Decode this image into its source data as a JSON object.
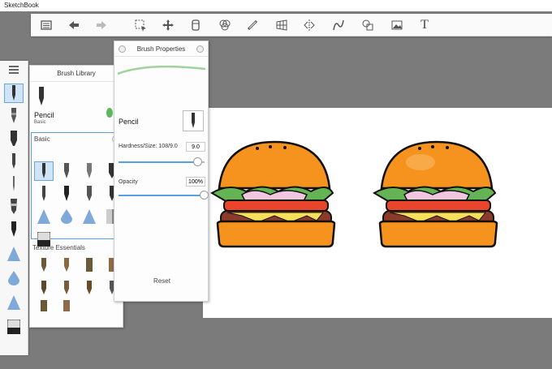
{
  "app": {
    "title": "SketchBook"
  },
  "toolbar": {
    "icons": [
      "list-icon",
      "undo-icon",
      "redo-icon",
      "select-icon",
      "move-icon",
      "layers-copy-icon",
      "symmetry-icon",
      "ruler-icon",
      "perspective-icon",
      "mirror-icon",
      "curve-icon",
      "shapes-icon",
      "image-icon",
      "text-icon"
    ],
    "text_glyph": "T"
  },
  "left_strip": {
    "menu_icon": "brush-library-toggle-icon",
    "tools": [
      "pencil",
      "ballpoint",
      "marker",
      "felt-tip",
      "airbrush",
      "smudge",
      "ink",
      "triangle",
      "drop",
      "triangle-2",
      "eraser"
    ],
    "selected": "pencil"
  },
  "brush_library": {
    "title": "Brush Library",
    "current_brush": {
      "name": "Pencil",
      "category": "Basic",
      "color": "#5cb85c"
    },
    "groups": [
      {
        "label": "Basic"
      },
      {
        "label": "Texture Essentials"
      }
    ]
  },
  "brush_properties": {
    "title": "Brush Properties",
    "brush_name": "Pencil",
    "hardness_label": "Hardness/Size: 108/9.0",
    "hardness_value": "9.0",
    "hardness_fraction": 0.92,
    "opacity_label": "Opacity",
    "opacity_value": "100%",
    "opacity_fraction": 1.0,
    "reset_label": "Reset",
    "stroke_color": "#9ed39a"
  },
  "colors": {
    "accent": "#5aa0e0",
    "bun": "#f6931e",
    "lettuce": "#64b456",
    "tomato": "#e8452c",
    "patty": "#8c3a2a",
    "cheese": "#f6e05a",
    "onion": "#f3c6df"
  }
}
